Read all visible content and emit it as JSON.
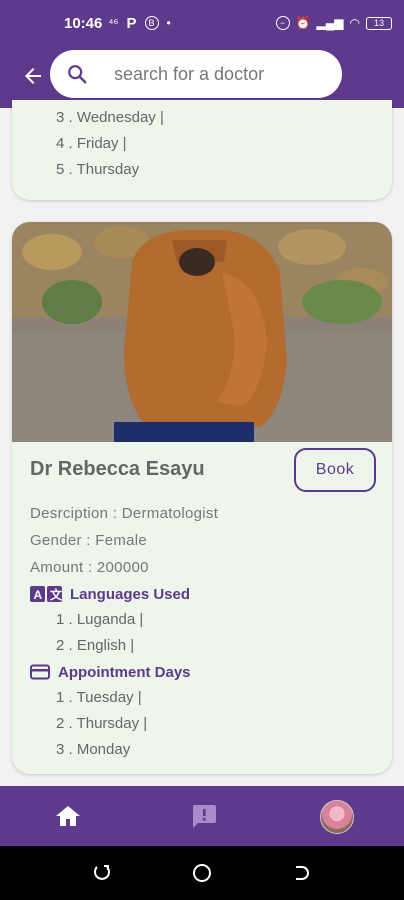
{
  "status_bar": {
    "time": "10:46",
    "left_icons": [
      "signal-small-icon",
      "parking-icon",
      "b-circle-icon",
      "dot-icon"
    ],
    "right_icons": [
      "dnd-icon",
      "alarm-icon",
      "signal-icon",
      "data-speed-icon",
      "wifi-icon",
      "battery-icon"
    ],
    "battery": "13"
  },
  "search": {
    "placeholder": "search for a doctor"
  },
  "previous_card": {
    "days": [
      "3 . Wednesday |",
      "4 . Friday |",
      "5 . Thursday"
    ]
  },
  "doctor": {
    "name": "Dr Rebecca  Esayu",
    "book_label": "Book",
    "description": "Desrciption  : Dermatologist",
    "gender": "Gender : Female",
    "amount": "Amount : 200000",
    "languages_heading": "Languages Used",
    "languages": [
      "1 . Luganda |",
      "2 . English |"
    ],
    "days_heading": "Appointment Days",
    "days": [
      "1 . Tuesday |",
      "2 . Thursday |",
      "3 . Monday"
    ]
  },
  "colors": {
    "primary": "#5e3a8c",
    "card_bg": "#eef5ea",
    "text": "#666666"
  },
  "bottom_nav": {
    "items": [
      "home-icon",
      "feedback-icon",
      "profile-avatar"
    ]
  }
}
